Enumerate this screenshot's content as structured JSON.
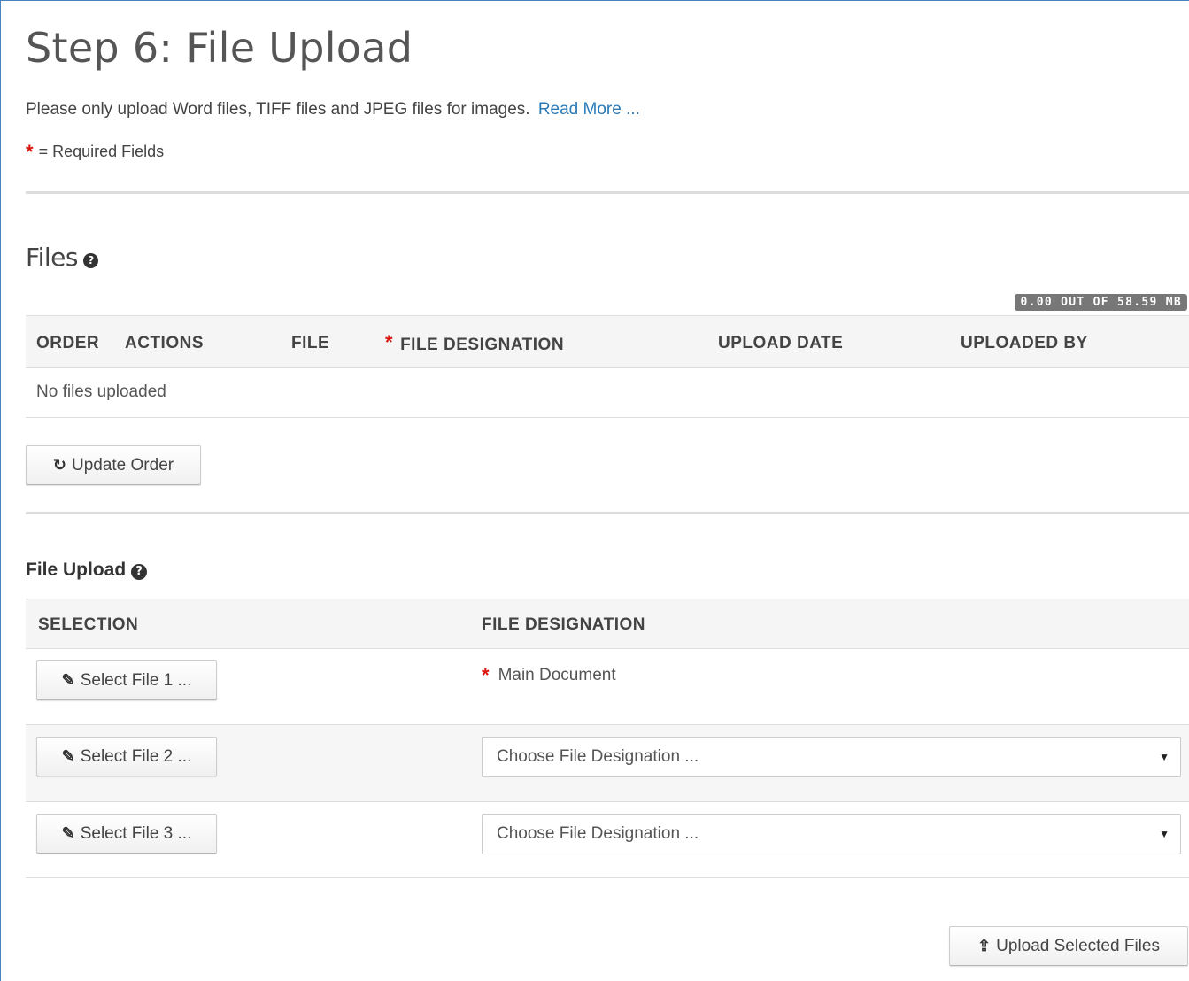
{
  "header": {
    "title": "Step 6: File Upload",
    "intro_text": "Please only upload Word files, TIFF files and JPEG files for images.",
    "read_more_link": "Read More ...",
    "required_star": "*",
    "required_note": "= Required Fields"
  },
  "files": {
    "title": "Files",
    "help_icon": "question-circle-icon",
    "quota": "0.00 OUT OF 58.59 MB",
    "columns": [
      "ORDER",
      "ACTIONS",
      "FILE",
      "FILE DESIGNATION",
      "UPLOAD DATE",
      "UPLOADED BY"
    ],
    "required_star": "*",
    "empty_message": "No files uploaded",
    "update_order_button": "Update Order",
    "update_order_icon": "refresh-icon"
  },
  "upload": {
    "title": "File Upload",
    "help_icon": "question-circle-icon",
    "columns": [
      "SELECTION",
      "FILE DESIGNATION"
    ],
    "rows": [
      {
        "select_label": "Select File 1 ...",
        "designation": "Main Document",
        "required_star": "*"
      },
      {
        "select_label": "Select File 2 ...",
        "designation_placeholder": "Choose File Designation ..."
      },
      {
        "select_label": "Select File 3 ...",
        "designation_placeholder": "Choose File Designation ..."
      }
    ],
    "paperclip_icon": "paperclip-icon",
    "dropdown_caret": "▼",
    "upload_button": "Upload Selected Files",
    "upload_icon": "upload-icon"
  },
  "colors": {
    "link": "#2a7ab8",
    "required_star": "#d9150f",
    "badge_bg": "#777777",
    "header_bg": "#f5f5f5"
  }
}
